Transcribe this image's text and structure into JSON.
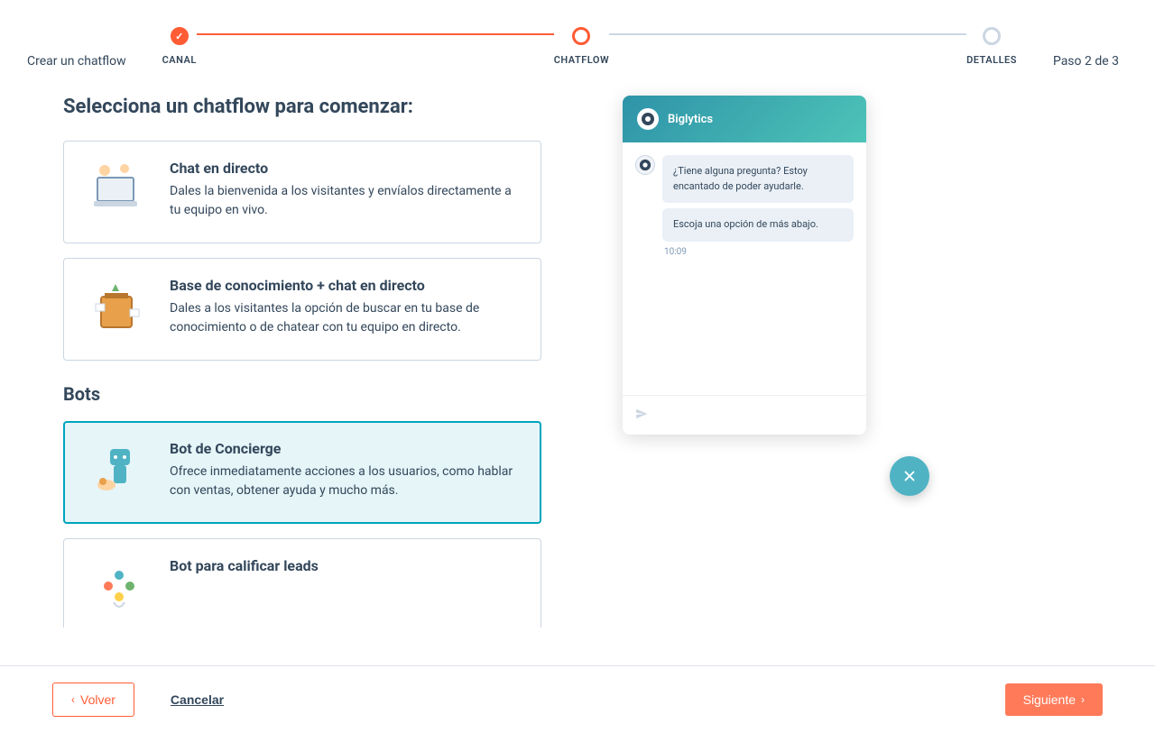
{
  "header": {
    "title": "Crear un chatflow",
    "step_counter": "Paso 2 de 3",
    "steps": [
      {
        "label": "CANAL",
        "state": "completed"
      },
      {
        "label": "CHATFLOW",
        "state": "current"
      },
      {
        "label": "DETALLES",
        "state": "upcoming"
      }
    ]
  },
  "page": {
    "heading": "Selecciona un chatflow para comenzar:",
    "section_bots": "Bots"
  },
  "cards": {
    "live_chat": {
      "title": "Chat en directo",
      "desc": "Dales la bienvenida a los visitantes y envíalos directamente a tu equipo en vivo."
    },
    "kb_chat": {
      "title": "Base de conocimiento + chat en directo",
      "desc": "Dales a los visitantes la opción de buscar en tu base de conocimiento o de chatear con tu equipo en directo."
    },
    "concierge": {
      "title": "Bot de Concierge",
      "desc": "Ofrece inmediatamente acciones a los usuarios, como hablar con ventas, obtener ayuda y mucho más."
    },
    "qualify": {
      "title": "Bot para calificar leads",
      "desc": ""
    }
  },
  "chat": {
    "brand": "Biglytics",
    "messages": [
      "¿Tiene alguna pregunta? Estoy encantado de poder ayudarle.",
      "Escoja una opción de más abajo."
    ],
    "time": "10:09"
  },
  "footer": {
    "back": "Volver",
    "cancel": "Cancelar",
    "next": "Siguiente"
  }
}
